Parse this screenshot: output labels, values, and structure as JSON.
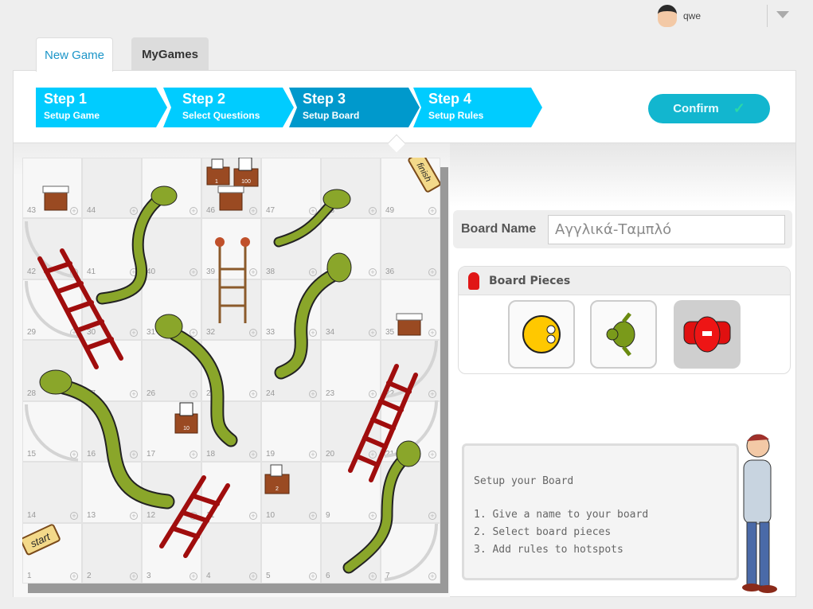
{
  "user": {
    "name": "qwe",
    "avatar_icon": "user-avatar-icon",
    "menu_icon": "chevron-down-icon"
  },
  "tabs": [
    {
      "label": "New Game",
      "active": true
    },
    {
      "label": "MyGames",
      "active": false
    }
  ],
  "steps": [
    {
      "title": "Step 1",
      "subtitle": "Setup Game",
      "active": false
    },
    {
      "title": "Step 2",
      "subtitle": "Select Questions",
      "active": false
    },
    {
      "title": "Step 3",
      "subtitle": "Setup Board",
      "active": true
    },
    {
      "title": "Step 4",
      "subtitle": "Setup Rules",
      "active": false
    }
  ],
  "confirm": {
    "label": "Confirm",
    "icon": "check-icon"
  },
  "colors": {
    "step": "#00ccff",
    "step_active": "#0099cc",
    "confirm": "#12b6cf",
    "snake": "#8aa62a",
    "ladder": "#a00d0d"
  },
  "board": {
    "rows": [
      [
        43,
        44,
        45,
        46,
        47,
        48,
        49
      ],
      [
        42,
        41,
        40,
        39,
        38,
        37,
        36
      ],
      [
        29,
        30,
        31,
        32,
        33,
        34,
        35
      ],
      [
        28,
        27,
        26,
        25,
        24,
        23,
        22
      ],
      [
        15,
        16,
        17,
        18,
        19,
        20,
        21
      ],
      [
        14,
        13,
        12,
        11,
        10,
        9,
        8
      ],
      [
        1,
        2,
        3,
        4,
        5,
        6,
        7
      ]
    ],
    "start_label": "start",
    "finish_label": "finish",
    "item_labels": {
      "dice_box": "1",
      "calculator_box": "100",
      "calculator_box_2": "10",
      "dice_box_2": "2"
    }
  },
  "board_name": {
    "label": "Board Name",
    "value": "Αγγλικά-Ταμπλό"
  },
  "pieces": {
    "title": "Board Pieces",
    "items": [
      {
        "name": "smiley",
        "selected": false
      },
      {
        "name": "turtle",
        "selected": false
      },
      {
        "name": "red-car",
        "selected": true
      }
    ]
  },
  "instructions": {
    "title": "Setup your Board",
    "lines": [
      "1. Give a name to your board",
      "2. Select board pieces",
      "3. Add rules to hotspots"
    ]
  }
}
